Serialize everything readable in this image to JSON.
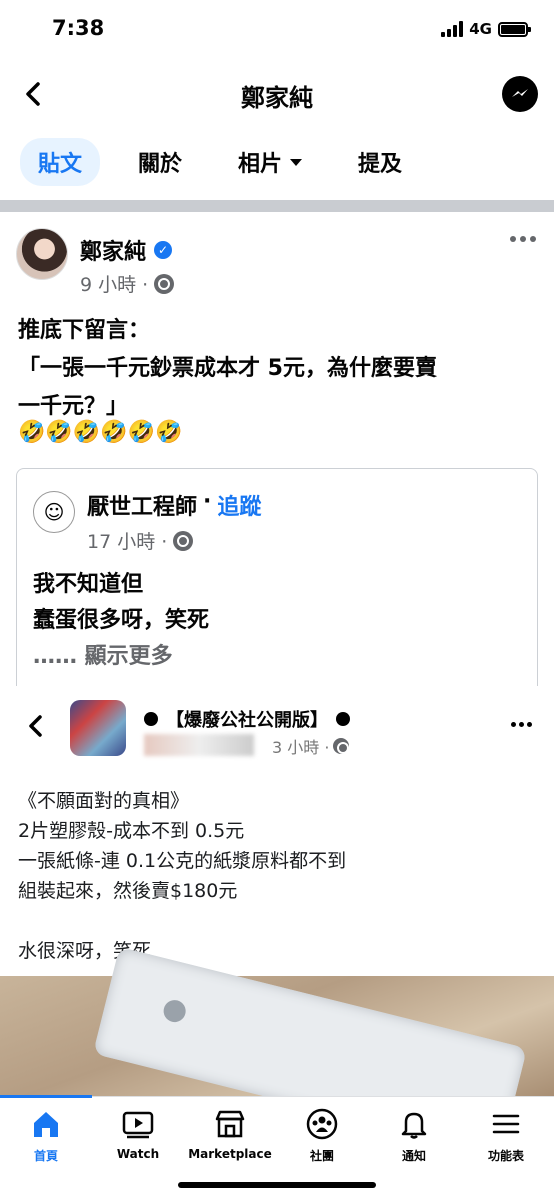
{
  "status": {
    "time": "7:38",
    "network": "4G"
  },
  "header": {
    "title": "鄭家純"
  },
  "tabs": [
    {
      "label": "貼文",
      "active": true
    },
    {
      "label": "關於"
    },
    {
      "label": "相片"
    },
    {
      "label": "提及"
    }
  ],
  "post": {
    "author": "鄭家純",
    "time": "9 小時 ·",
    "text_lines": [
      "推底下留言：",
      "「一張一千元鈔票成本才 5元，為什麼要賣",
      "一千元？」"
    ],
    "emojis": "🤣🤣🤣🤣🤣🤣"
  },
  "shared": {
    "author": "厭世工程師",
    "dot": "·",
    "follow": "追蹤",
    "time": "17 小時 ·",
    "text_lines": [
      "我不知道但",
      "蠢蛋很多呀，笑死"
    ],
    "see_more": "…… 顯示更多"
  },
  "inner": {
    "group": "【爆廢公社公開版】",
    "time": "3 小時 ·",
    "text_lines": [
      "《不願面對的真相》",
      "2片塑膠殼-成本不到 0.5元",
      "一張紙條-連 0.1公克的紙漿原料都不到",
      "組裝起來，然後賣$180元",
      "",
      "水很深呀，笑死"
    ]
  },
  "bottom_nav": [
    {
      "label": "首頁",
      "icon": "home-icon",
      "active": true
    },
    {
      "label": "Watch",
      "icon": "watch-icon"
    },
    {
      "label": "Marketplace",
      "icon": "marketplace-icon"
    },
    {
      "label": "社團",
      "icon": "groups-icon"
    },
    {
      "label": "通知",
      "icon": "bell-icon"
    },
    {
      "label": "功能表",
      "icon": "menu-icon"
    }
  ],
  "colors": {
    "accent": "#1877f2",
    "secondary_text": "#65676b"
  }
}
